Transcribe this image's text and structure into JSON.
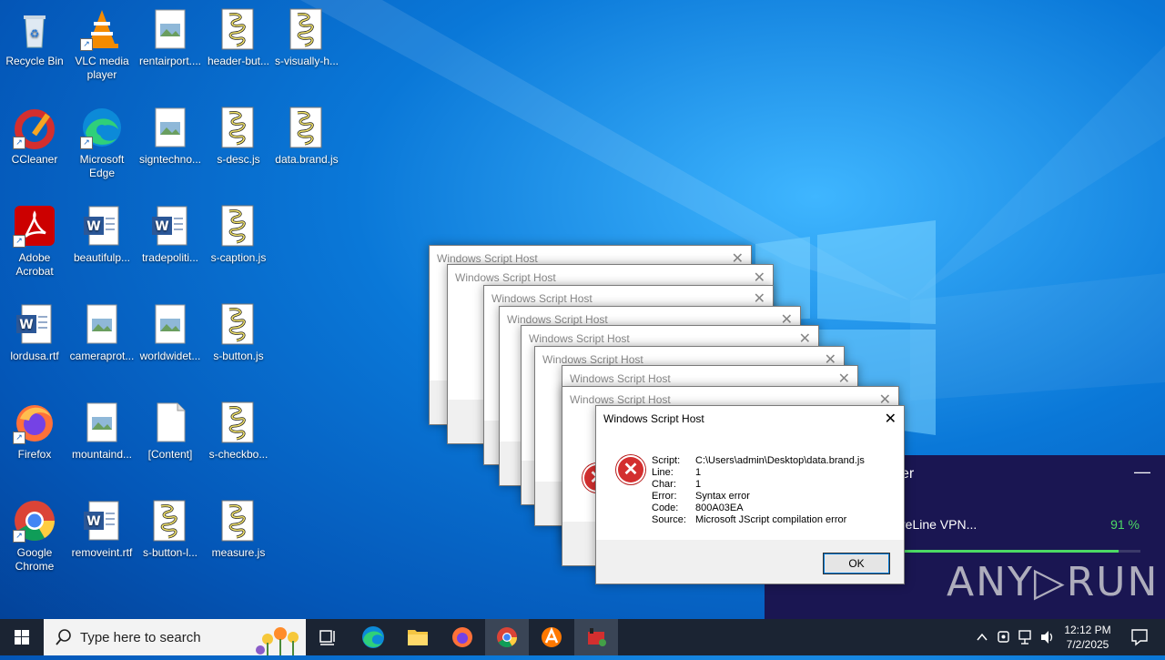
{
  "desktop": {
    "icons": [
      {
        "label": "Recycle Bin"
      },
      {
        "label": "VLC media player"
      },
      {
        "label": "rentairport...."
      },
      {
        "label": "header-but..."
      },
      {
        "label": "s-visually-h..."
      },
      {
        "label": "CCleaner"
      },
      {
        "label": "Microsoft Edge"
      },
      {
        "label": "signtechno..."
      },
      {
        "label": "s-desc.js"
      },
      {
        "label": "data.brand.js"
      },
      {
        "label": "Adobe Acrobat"
      },
      {
        "label": "beautifulp..."
      },
      {
        "label": "tradepoliti..."
      },
      {
        "label": "s-caption.js"
      },
      {
        "label": "lordusa.rtf"
      },
      {
        "label": "cameraprot..."
      },
      {
        "label": "worldwidet..."
      },
      {
        "label": "s-button.js"
      },
      {
        "label": "Firefox"
      },
      {
        "label": "mountaind..."
      },
      {
        "label": "[Content]"
      },
      {
        "label": "s-checkbo..."
      },
      {
        "label": "Google Chrome"
      },
      {
        "label": "removeint.rtf"
      },
      {
        "label": "s-button-l..."
      },
      {
        "label": "measure.js"
      }
    ]
  },
  "dialogs": {
    "title": "Windows Script Host",
    "close_glyph": "✕",
    "error_glyph": "✕",
    "main": {
      "fields": [
        {
          "key": "Script:",
          "value": "C:\\Users\\admin\\Desktop\\data.brand.js"
        },
        {
          "key": "Line:",
          "value": "1"
        },
        {
          "key": "Char:",
          "value": "1"
        },
        {
          "key": "Error:",
          "value": "Syntax error"
        },
        {
          "key": "Code:",
          "value": "800A03EA"
        },
        {
          "key": "Source:",
          "value": "Microsoft JScript compilation error"
        }
      ],
      "ok_label": "OK"
    }
  },
  "panel": {
    "title": "er",
    "minimize_glyph": "—",
    "item_label": "reLine VPN...",
    "progress_text": "91 %",
    "progress": 0.91,
    "accent": "#4cd964"
  },
  "watermark": "ANY▷RUN",
  "taskbar": {
    "search_placeholder": "Type here to search",
    "icons": [
      "task-view-icon",
      "edge-icon",
      "file-explorer-icon",
      "firefox-icon",
      "chrome-icon",
      "avast-icon",
      "script-app-icon"
    ],
    "time": "12:12 PM",
    "date": "7/2/2025"
  },
  "colors": {
    "taskbar": "#1b2433",
    "panel": "#1a1652",
    "error_red": "#d32f2f"
  }
}
